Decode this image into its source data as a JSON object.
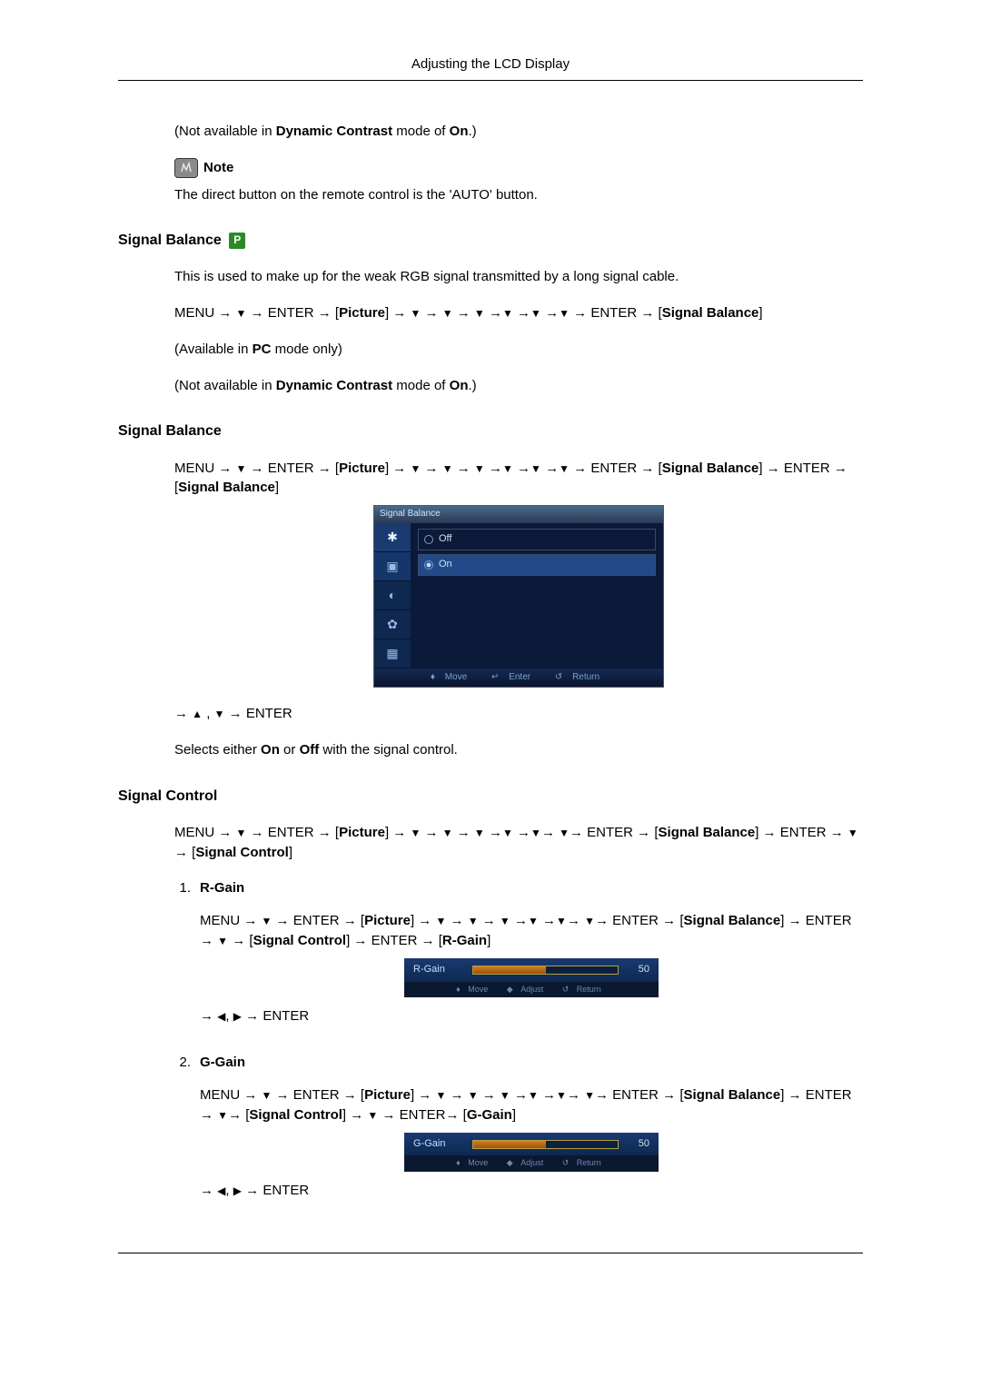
{
  "page_title": "Adjusting the LCD Display",
  "intro": {
    "not_avail": "(Not available in ",
    "dyn_contrast": "Dynamic Contrast",
    "mode_of": " mode of ",
    "on": "On",
    "close": ".)",
    "note_label": "Note",
    "note_text": "The direct button on the remote control is the 'AUTO' button."
  },
  "sec1": {
    "heading": "Signal Balance",
    "badge": "P",
    "desc": "This is used to make up for the weak RGB signal transmitted by a long signal cable.",
    "menu_prefix": "MENU → ",
    "enter": "ENTER",
    "picture": "Picture",
    "arrow_to": " → ",
    "signal_balance": "Signal Balance",
    "avail": "(Available in ",
    "pc": "PC",
    "mode_only": " mode only)"
  },
  "sec2": {
    "heading": "Signal Balance",
    "signal_balance_text": "Signal Balance",
    "osd": {
      "title": "Signal Balance",
      "opt_off": "Off",
      "opt_on": "On",
      "footer_move": "Move",
      "footer_enter": "Enter",
      "footer_return": "Return"
    },
    "nav_enter": "ENTER",
    "selects_pre": "Selects either ",
    "on": "On",
    "or": " or ",
    "off": "Off",
    "selects_post": " with the signal control."
  },
  "sec3": {
    "heading": "Signal Control",
    "menu_pre": "MENU → ",
    "enter": "ENTER",
    "picture": "Picture",
    "signal_balance": "Signal Balance",
    "signal_control": "Signal Control",
    "items": [
      {
        "num": "1.",
        "name": "R-Gain",
        "gain_label": "R-Gain",
        "gain_value": "50",
        "target": "R-Gain"
      },
      {
        "num": "2.",
        "name": "G-Gain",
        "gain_label": "G-Gain",
        "gain_value": "50",
        "target": "G-Gain"
      }
    ],
    "footer": {
      "move": "Move",
      "adjust": "Adjust",
      "return": "Return"
    }
  }
}
